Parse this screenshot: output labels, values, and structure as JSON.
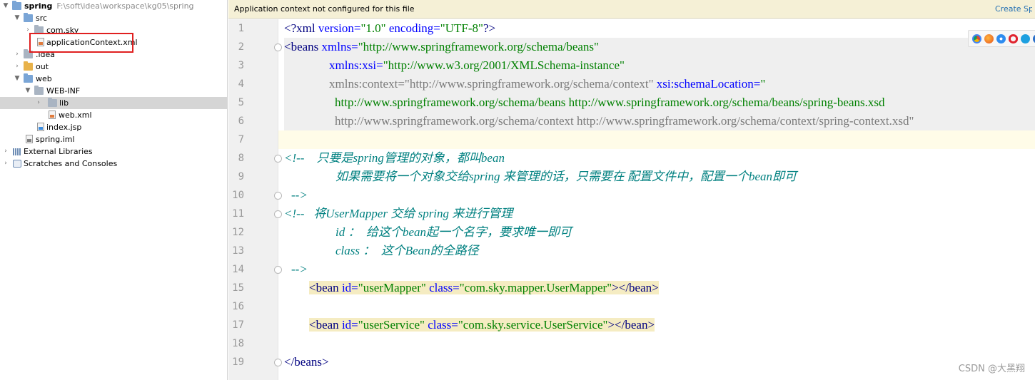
{
  "tree": {
    "project_name": "spring",
    "project_path": "F:\\soft\\idea\\workspace\\kg05\\spring",
    "items": [
      {
        "label": "src",
        "icon": "folder-icon"
      },
      {
        "label": "com.sky",
        "icon": "package-icon"
      },
      {
        "label": "applicationContext.xml",
        "icon": "xml-file-icon"
      },
      {
        "label": ".idea",
        "icon": "folder-icon"
      },
      {
        "label": "out",
        "icon": "folder-icon"
      },
      {
        "label": "web",
        "icon": "web-folder-icon"
      },
      {
        "label": "WEB-INF",
        "icon": "folder-icon"
      },
      {
        "label": "lib",
        "icon": "folder-icon"
      },
      {
        "label": "web.xml",
        "icon": "xml-file-icon"
      },
      {
        "label": "index.jsp",
        "icon": "jsp-file-icon"
      },
      {
        "label": "spring.iml",
        "icon": "iml-file-icon"
      },
      {
        "label": "External Libraries",
        "icon": "libraries-icon"
      },
      {
        "label": "Scratches and Consoles",
        "icon": "scratches-icon"
      }
    ]
  },
  "editor": {
    "banner": "Application context not configured for this file",
    "banner_link": "Create Spring facet",
    "line_numbers": [
      "1",
      "2",
      "3",
      "4",
      "5",
      "6",
      "7",
      "8",
      "9",
      "10",
      "11",
      "12",
      "13",
      "14",
      "15",
      "16",
      "17",
      "18",
      "19"
    ],
    "code": {
      "l1_a": "<?",
      "l1_b": "xml",
      "l1_c": " version=",
      "l1_d": "\"1.0\"",
      "l1_e": " encoding=",
      "l1_f": "\"UTF-8\"",
      "l1_g": "?>",
      "l2_a": "<beans",
      "l2_b": " xmlns=",
      "l2_c": "\"http://www.springframework.org/schema/beans\"",
      "l3_a": "xmlns:xsi=",
      "l3_b": "\"http://www.w3.org/2001/XMLSchema-instance\"",
      "l4_a": "xmlns:context=",
      "l4_b": "\"http://www.springframework.org/schema/context\"",
      "l4_c": " xsi:schemaLocation=",
      "l4_d": "\"",
      "l5": "http://www.springframework.org/schema/beans http://www.springframework.org/schema/beans/spring-beans.xsd",
      "l6": "http://www.springframework.org/schema/context http://www.springframework.org/schema/context/spring-context.xsd\"",
      "l8": "<!--    只要是spring管理的对象，都叫bean",
      "l9": "如果需要将一个对象交给spring 来管理的话，只需要在 配置文件中，配置一个bean即可",
      "l10": "-->",
      "l11": "<!--   将UserMapper 交给 spring 来进行管理",
      "l12": "id ：  给这个bean起一个名字，要求唯一即可",
      "l13": "class ：  这个Bean的全路径",
      "l14": "-->",
      "l15_a": "<bean",
      "l15_b": " id=",
      "l15_c": "\"userMapper\"",
      "l15_d": " class=",
      "l15_e": "\"com.sky.mapper.UserMapper\"",
      "l15_f": "></bean>",
      "l17_a": "<bean",
      "l17_b": " id=",
      "l17_c": "\"userService\"",
      "l17_d": " class=",
      "l17_e": "\"com.sky.service.UserService\"",
      "l17_f": "></bean>",
      "l19": "</beans>"
    }
  },
  "browser_icons": [
    "chrome-icon",
    "firefox-icon",
    "safari-icon",
    "opera-icon",
    "ie-icon",
    "edge-icon"
  ],
  "watermark": "CSDN @大黑翔",
  "colors": {
    "tag": "#000080",
    "attribute": "#0000ff",
    "value": "#008000",
    "comment": "#008080",
    "selection_box": "#e02020",
    "banner_bg": "#f5f0d6"
  }
}
